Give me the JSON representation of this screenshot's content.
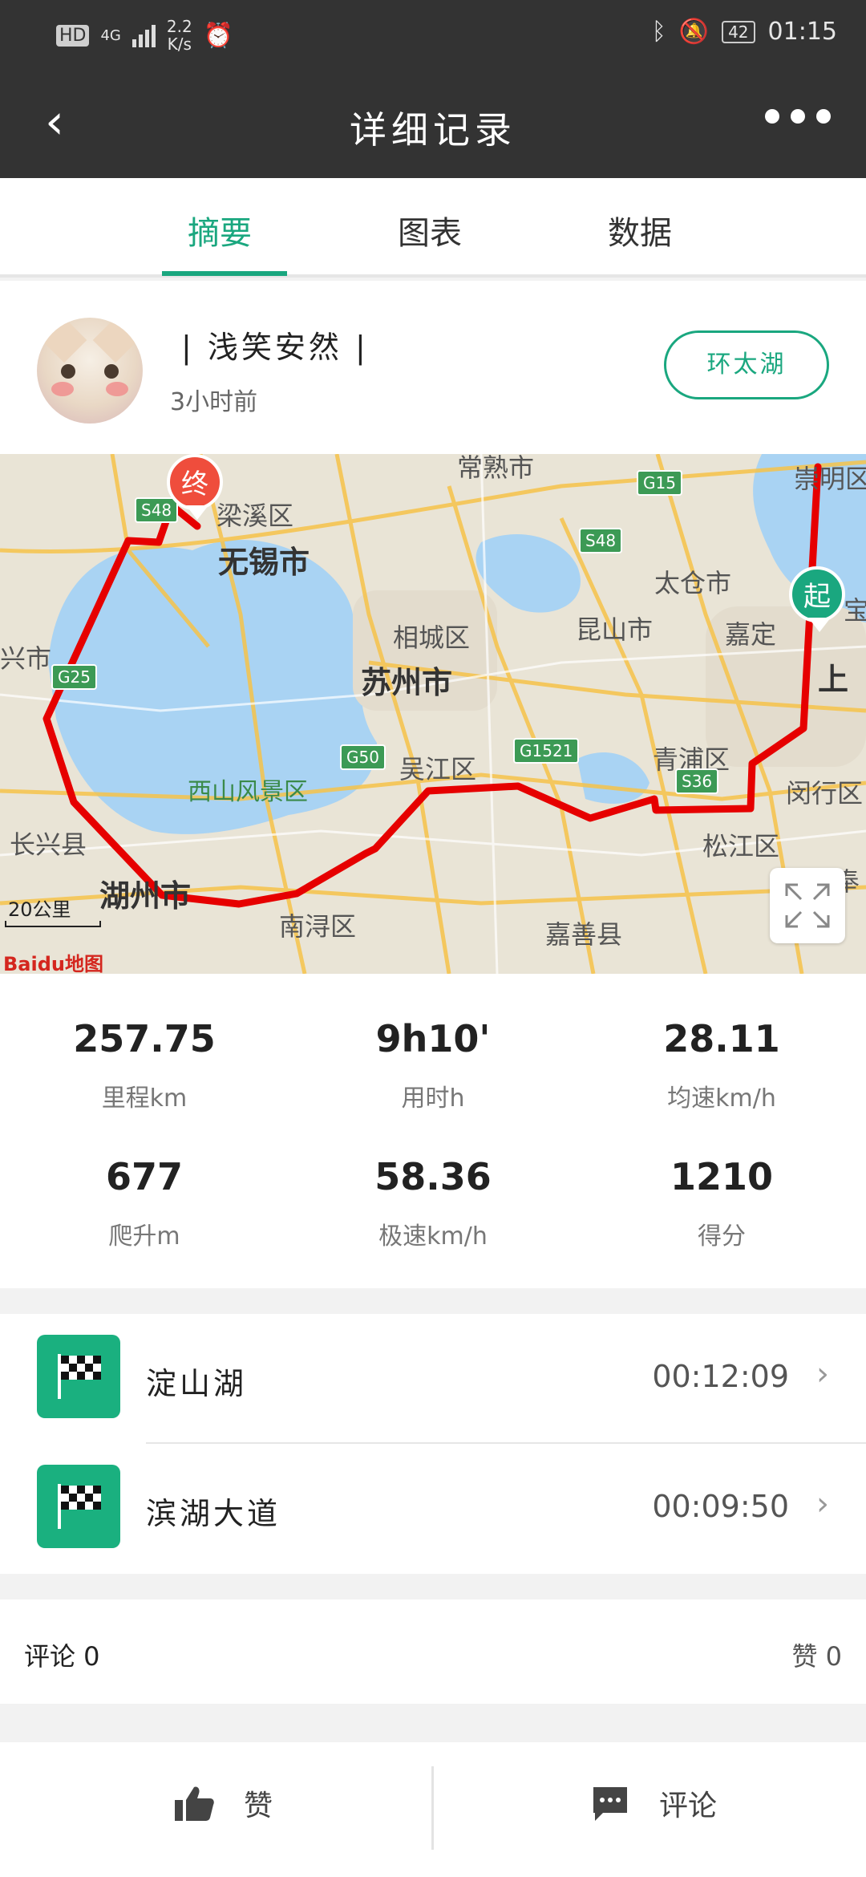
{
  "status": {
    "net_speed": "2.2",
    "net_unit": "K/s",
    "battery": "42",
    "time": "01:15",
    "hd": "HD",
    "signal": "4G"
  },
  "header": {
    "title": "详细记录"
  },
  "tabs": [
    {
      "label": "摘要",
      "active": true
    },
    {
      "label": "图表"
    },
    {
      "label": "数据"
    }
  ],
  "profile": {
    "username": "| 浅笑安然 |",
    "time_ago": "3小时前",
    "route_tag": "环太湖"
  },
  "map": {
    "labels": [
      "常熟市",
      "崇明区",
      "梁溪区",
      "无锡市",
      "太仓市",
      "兴市",
      "相城区",
      "昆山市",
      "嘉定",
      "宝",
      "苏州市",
      "上",
      "吴江区",
      "青浦区",
      "闵行区",
      "西山风景区",
      "长兴县",
      "松江区",
      "湖州市",
      "南浔区",
      "嘉善县",
      "奉"
    ],
    "roads": [
      "G15",
      "S48",
      "S48",
      "G25",
      "G50",
      "G1521",
      "S36"
    ],
    "start_label": "起",
    "end_label": "终",
    "scale": "20公里",
    "attribution": "Baidu地图"
  },
  "stats": [
    {
      "value": "257.75",
      "label": "里程km"
    },
    {
      "value": "9h10'",
      "label": "用时h"
    },
    {
      "value": "28.11",
      "label": "均速km/h"
    },
    {
      "value": "677",
      "label": "爬升m"
    },
    {
      "value": "58.36",
      "label": "极速km/h"
    },
    {
      "value": "1210",
      "label": "得分"
    }
  ],
  "segments": [
    {
      "name": "淀山湖",
      "duration": "00:12:09"
    },
    {
      "name": "滨湖大道",
      "duration": "00:09:50"
    }
  ],
  "comments": {
    "comments_label": "评论 0",
    "likes_label": "赞 0"
  },
  "bottom": {
    "like": "赞",
    "comment": "评论"
  },
  "colors": {
    "accent": "#1aa77f",
    "route": "#e60000",
    "header": "#333333"
  }
}
